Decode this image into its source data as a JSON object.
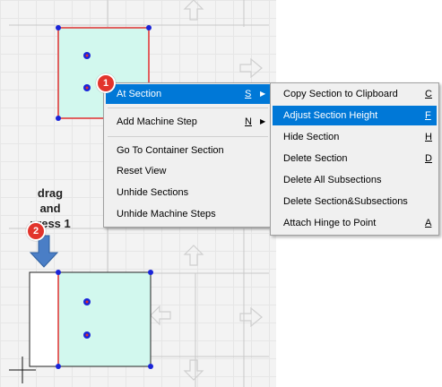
{
  "context_menu": {
    "items": [
      {
        "label": "At Section",
        "shortcut": "S",
        "submenu": true
      },
      {
        "label": "Add Machine Step",
        "shortcut": "N",
        "submenu": true
      },
      {
        "label": "Go To Container Section"
      },
      {
        "label": "Reset View"
      },
      {
        "label": "Unhide Sections"
      },
      {
        "label": "Unhide Machine Steps"
      }
    ]
  },
  "submenu": {
    "items": [
      {
        "label": "Copy Section to Clipboard",
        "shortcut": "C"
      },
      {
        "label": "Adjust Section Height",
        "shortcut": "F"
      },
      {
        "label": "Hide Section",
        "shortcut": "H"
      },
      {
        "label": "Delete Section",
        "shortcut": "D"
      },
      {
        "label": "Delete All Subsections",
        "shortcut": ""
      },
      {
        "label": "Delete Section&Subsections",
        "shortcut": ""
      },
      {
        "label": "Attach Hinge to Point",
        "shortcut": "A"
      }
    ]
  },
  "instruction": {
    "line1": "drag",
    "line2": "and",
    "line3": "press 1"
  },
  "badges": {
    "step1": "1",
    "step2": "2"
  },
  "colors": {
    "highlight": "#0078d7",
    "section_fill": "#d2f8ee",
    "selected_border": "#e03030",
    "handle": "#1a24d8",
    "badge": "#e2342c",
    "arrow": "#4a7ec6"
  },
  "icons": [
    "crosshair-cursor-icon",
    "down-arrow-icon",
    "arrow-outline-icon"
  ]
}
